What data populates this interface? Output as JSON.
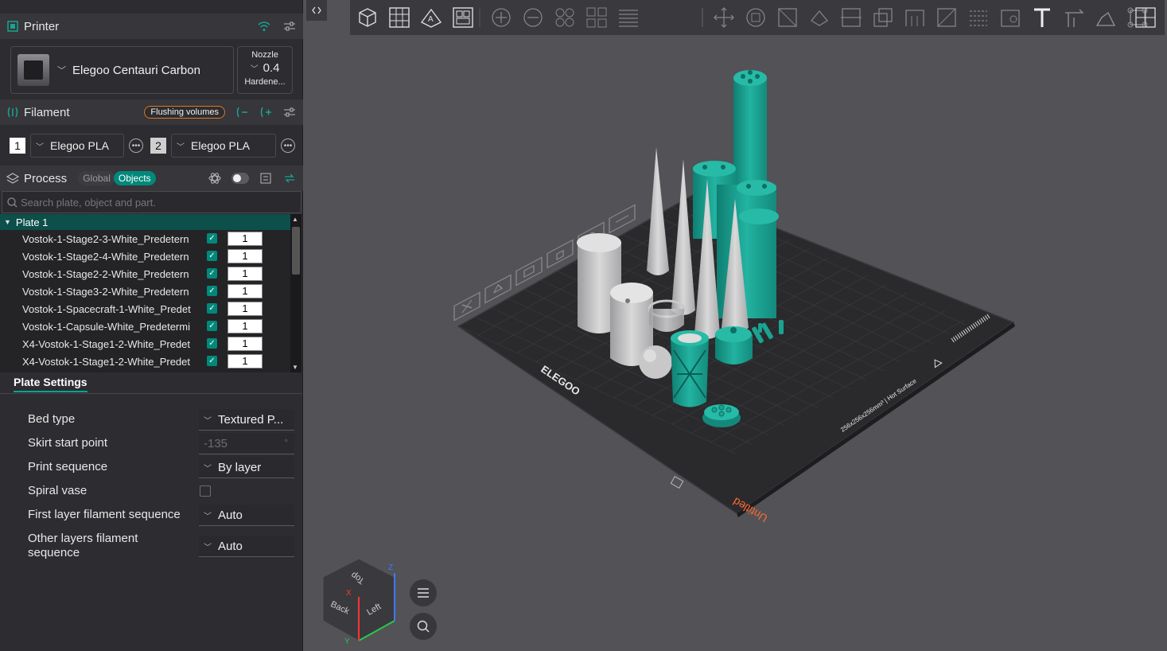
{
  "printer": {
    "section_title": "Printer",
    "name": "Elegoo Centauri Carbon",
    "nozzle_label": "Nozzle",
    "nozzle_value": "0.4",
    "nozzle_type": "Hardene..."
  },
  "filament": {
    "section_title": "Filament",
    "flushing_label": "Flushing volumes",
    "slots": [
      {
        "index": "1",
        "name": "Elegoo PLA",
        "color": "#ffffff"
      },
      {
        "index": "2",
        "name": "Elegoo PLA",
        "color": "#cfcfcf"
      }
    ]
  },
  "process": {
    "section_title": "Process",
    "toggle_global": "Global",
    "toggle_objects": "Objects"
  },
  "search": {
    "placeholder": "Search plate, object and part."
  },
  "tree": {
    "plate_label": "Plate 1",
    "objects": [
      {
        "name": "Vostok-1-Stage2-3-White_Predetern",
        "qty": "1"
      },
      {
        "name": "Vostok-1-Stage2-4-White_Predetern",
        "qty": "1"
      },
      {
        "name": "Vostok-1-Stage2-2-White_Predetern",
        "qty": "1"
      },
      {
        "name": "Vostok-1-Stage3-2-White_Predetern",
        "qty": "1"
      },
      {
        "name": "Vostok-1-Spacecraft-1-White_Predet",
        "qty": "1"
      },
      {
        "name": "Vostok-1-Capsule-White_Predetermi",
        "qty": "1"
      },
      {
        "name": "X4-Vostok-1-Stage1-2-White_Predet",
        "qty": "1"
      },
      {
        "name": "X4-Vostok-1-Stage1-2-White_Predet",
        "qty": "1"
      }
    ]
  },
  "plate_settings": {
    "tab_label": "Plate Settings",
    "rows": [
      {
        "label": "Bed type",
        "value": "Textured P..."
      },
      {
        "label": "Skirt start point",
        "value": "-135",
        "unit": "°"
      },
      {
        "label": "Print sequence",
        "value": "By layer"
      },
      {
        "label": "Spiral vase",
        "value": ""
      },
      {
        "label": "First layer filament sequence",
        "value": "Auto"
      },
      {
        "label": "Other layers filament",
        "label2": "sequence",
        "value": "Auto"
      }
    ]
  },
  "bed": {
    "brand": "ELEGOO",
    "size_text": "256x256x256mm³ | Hot Surface",
    "plate_name": "Untitled"
  },
  "view_cube": {
    "top": "Top",
    "back": "Back",
    "left": "Left",
    "axis_x": "X",
    "axis_y": "Y",
    "axis_z": "Z"
  },
  "colors": {
    "accent": "#00897b",
    "teal_model": "#1aa391",
    "gray_model": "#c4c4c4",
    "flush_border": "#e0761e",
    "plate_name": "#ff6a2e"
  }
}
